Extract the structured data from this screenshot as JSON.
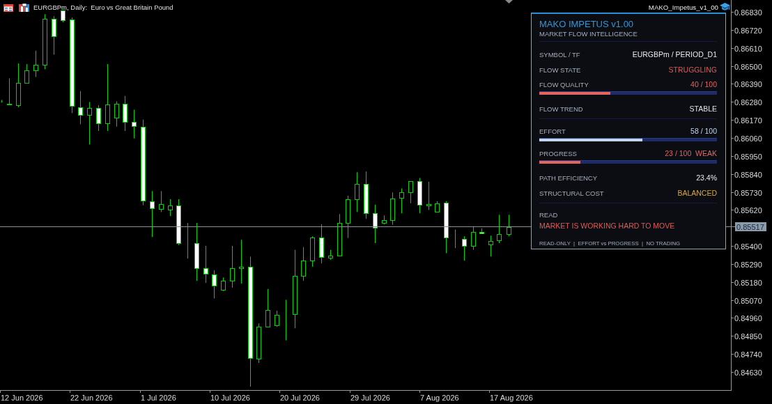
{
  "chart_window": {
    "symbol_title": "EURGBPm, Daily:  Euro vs Great Britain Pound",
    "indicator_label": "MAKO_Impetus_v1_00"
  },
  "price_axis": {
    "labels": [
      "0.86830",
      "0.86720",
      "0.86610",
      "0.86500",
      "0.86390",
      "0.86280",
      "0.86170",
      "0.86060",
      "0.85950",
      "0.85840",
      "0.85730",
      "0.85620",
      "0.85400",
      "0.85290",
      "0.85180",
      "0.85070",
      "0.84960",
      "0.84850",
      "0.84740",
      "0.84630"
    ],
    "current_price": "0.85517"
  },
  "time_axis": {
    "labels": [
      "12 Jun 2026",
      "22 Jun 2026",
      "1 Jul 2026",
      "10 Jul 2026",
      "20 Jul 2026",
      "29 Jul 2026",
      "7 Aug 2026",
      "17 Aug 2026"
    ]
  },
  "panel": {
    "title": "MAKO IMPETUS v1.00",
    "subtitle": "MARKET FLOW INTELLIGENCE",
    "sections": [
      {
        "rows": [
          {
            "kind": "field",
            "label": "SYMBOL / TF",
            "value": "EURGBPm / PERIOD_D1",
            "color": "#e6e9ee"
          },
          {
            "kind": "field",
            "label": "FLOW STATE",
            "value": "STRUGGLING",
            "color": "#e05a55"
          },
          {
            "kind": "meter",
            "label": "FLOW QUALITY",
            "value": "40 / 100",
            "color": "#e36560",
            "level": 0.4
          },
          {
            "kind": "field",
            "label": "FLOW TREND",
            "value": "STABLE",
            "color": "#dfe3ea"
          }
        ]
      },
      {
        "rows": [
          {
            "kind": "meter",
            "label": "EFFORT",
            "value": "58 / 100",
            "color": "#c2d6ec",
            "level": 0.58
          },
          {
            "kind": "meter",
            "label": "PROGRESS",
            "value": "23 / 100  WEAK",
            "color": "#e36560",
            "level": 0.23
          },
          {
            "kind": "field",
            "label": "PATH EFFICIENCY",
            "value": "23.4%",
            "color": "#e6e9ee"
          },
          {
            "kind": "field",
            "label": "STRUCTURAL COST",
            "value": "BALANCED",
            "color": "#d9a82e"
          }
        ]
      }
    ],
    "read": {
      "label": "READ",
      "message": "MARKET IS WORKING HARD TO MOVE",
      "color": "#e05a55"
    },
    "footer": "READ-ONLY  |  EFFORT vs PROGRESS  |  NO TRADING"
  }
}
